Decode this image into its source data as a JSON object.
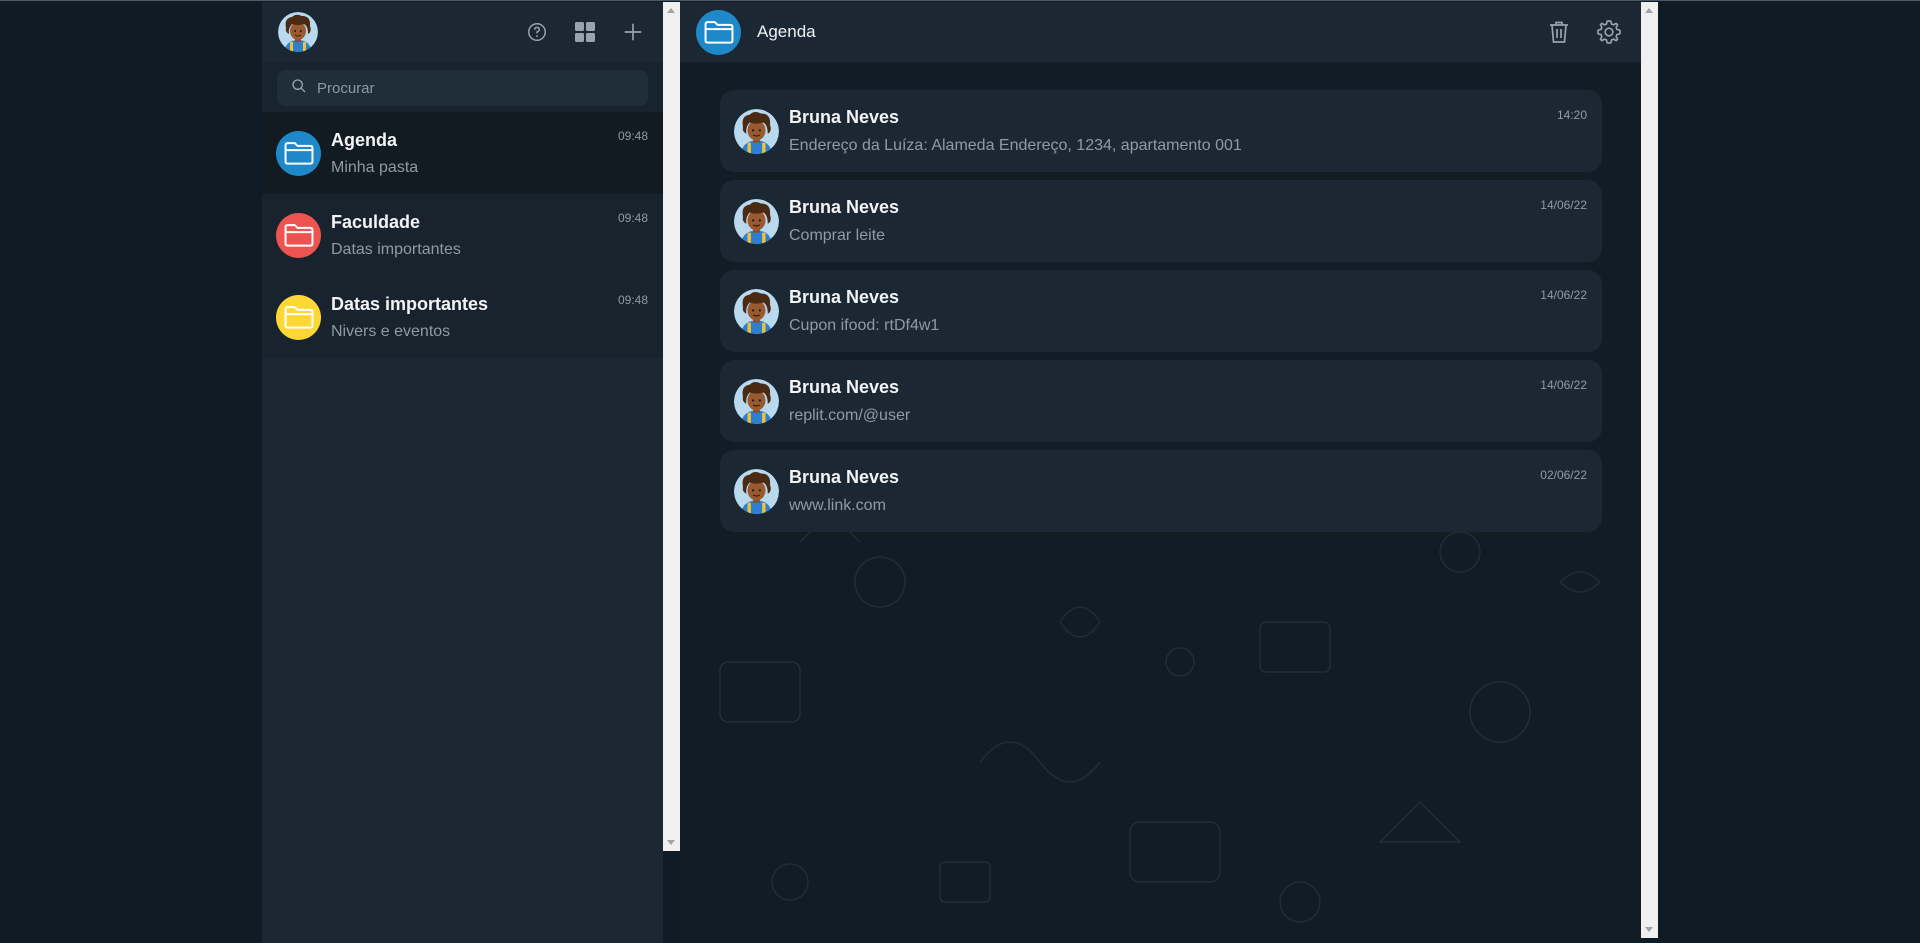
{
  "sidebar": {
    "header": {
      "avatar_alt": "Perfil",
      "help_icon": "help-circle-icon",
      "grid_icon": "grid-icon",
      "add_icon": "plus-icon"
    },
    "search": {
      "placeholder": "Procurar"
    },
    "folders": [
      {
        "name": "Agenda",
        "subtitle": "Minha pasta",
        "time": "09:48",
        "color": "#1f88c8",
        "active": true
      },
      {
        "name": "Faculdade",
        "subtitle": "Datas importantes",
        "time": "09:48",
        "color": "#ef5350",
        "active": false
      },
      {
        "name": "Datas importantes",
        "subtitle": "Nivers e eventos",
        "time": "09:48",
        "color": "#fdd835",
        "active": false
      }
    ]
  },
  "main": {
    "header": {
      "title": "Agenda",
      "color": "#1f88c8"
    },
    "notes": [
      {
        "author": "Bruna Neves",
        "text": "Endereço da Luíza: Alameda Endereço, 1234, apartamento 001",
        "time": "14:20"
      },
      {
        "author": "Bruna Neves",
        "text": "Comprar leite",
        "time": "14/06/22"
      },
      {
        "author": "Bruna Neves",
        "text": "Cupon ifood: rtDf4w1",
        "time": "14/06/22"
      },
      {
        "author": "Bruna Neves",
        "text": "replit.com/@user",
        "time": "14/06/22"
      },
      {
        "author": "Bruna Neves",
        "text": "www.link.com",
        "time": "02/06/22"
      }
    ]
  }
}
